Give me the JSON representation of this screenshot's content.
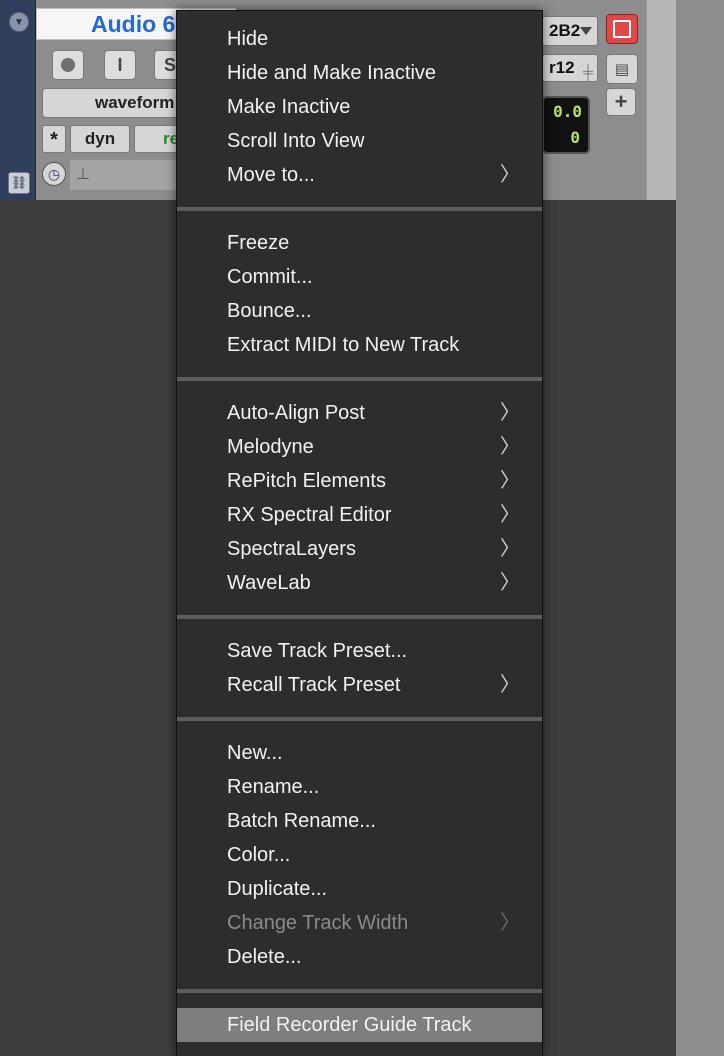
{
  "track": {
    "name": "Audio 6",
    "view": "waveform",
    "dyn_label": "dyn",
    "auto_label": "read",
    "star_label": "*",
    "input_label": "I",
    "solo_label": "S",
    "output": "2B2",
    "voice": "r12",
    "volume": "0.0",
    "pan": "0"
  },
  "menu": {
    "groups": [
      [
        {
          "label": "Hide",
          "submenu": false,
          "enabled": true
        },
        {
          "label": "Hide and Make Inactive",
          "submenu": false,
          "enabled": true
        },
        {
          "label": "Make Inactive",
          "submenu": false,
          "enabled": true
        },
        {
          "label": "Scroll Into View",
          "submenu": false,
          "enabled": true
        },
        {
          "label": "Move to...",
          "submenu": true,
          "enabled": true
        }
      ],
      [
        {
          "label": "Freeze",
          "submenu": false,
          "enabled": true
        },
        {
          "label": "Commit...",
          "submenu": false,
          "enabled": true
        },
        {
          "label": "Bounce...",
          "submenu": false,
          "enabled": true
        },
        {
          "label": "Extract MIDI to New Track",
          "submenu": false,
          "enabled": true
        }
      ],
      [
        {
          "label": "Auto-Align Post",
          "submenu": true,
          "enabled": true
        },
        {
          "label": "Melodyne",
          "submenu": true,
          "enabled": true
        },
        {
          "label": "RePitch Elements",
          "submenu": true,
          "enabled": true
        },
        {
          "label": "RX Spectral Editor",
          "submenu": true,
          "enabled": true
        },
        {
          "label": "SpectraLayers",
          "submenu": true,
          "enabled": true
        },
        {
          "label": "WaveLab",
          "submenu": true,
          "enabled": true
        }
      ],
      [
        {
          "label": "Save Track Preset...",
          "submenu": false,
          "enabled": true
        },
        {
          "label": "Recall Track Preset",
          "submenu": true,
          "enabled": true
        }
      ],
      [
        {
          "label": "New...",
          "submenu": false,
          "enabled": true
        },
        {
          "label": "Rename...",
          "submenu": false,
          "enabled": true
        },
        {
          "label": "Batch Rename...",
          "submenu": false,
          "enabled": true
        },
        {
          "label": "Color...",
          "submenu": false,
          "enabled": true
        },
        {
          "label": "Duplicate...",
          "submenu": false,
          "enabled": true
        },
        {
          "label": "Change Track Width",
          "submenu": true,
          "enabled": false
        },
        {
          "label": "Delete...",
          "submenu": false,
          "enabled": true
        }
      ],
      [
        {
          "label": "Field Recorder Guide Track",
          "submenu": false,
          "enabled": true,
          "highlighted": true
        }
      ]
    ],
    "chevron_glyph": "〉"
  }
}
